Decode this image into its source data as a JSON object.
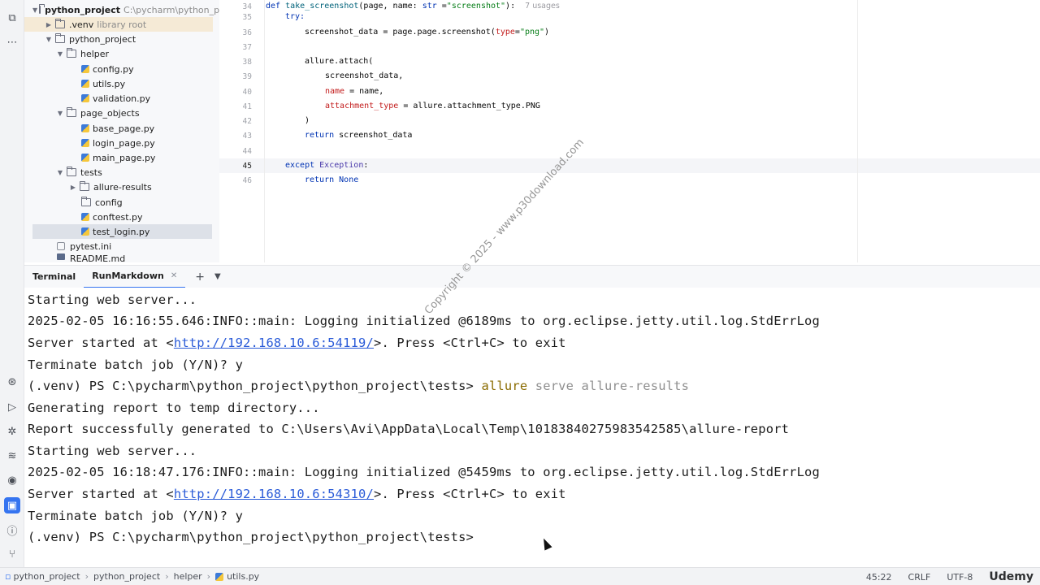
{
  "project_tree": {
    "root": {
      "name": "python_project",
      "path": "C:\\pycharm\\python_project"
    },
    "venv": {
      "name": ".venv",
      "note": "library root"
    },
    "inner_project": "python_project",
    "helper": {
      "name": "helper",
      "files": [
        "config.py",
        "utils.py",
        "validation.py"
      ]
    },
    "page_objects": {
      "name": "page_objects",
      "files": [
        "base_page.py",
        "login_page.py",
        "main_page.py"
      ]
    },
    "tests": {
      "name": "tests",
      "allure_results": "allure-results",
      "config": "config",
      "files": [
        "conftest.py",
        "test_login.py"
      ]
    },
    "pytest_ini": "pytest.ini",
    "readme": "README.md"
  },
  "editor": {
    "line_numbers": [
      "34",
      "35",
      "36",
      "37",
      "38",
      "39",
      "40",
      "41",
      "42",
      "43",
      "44",
      "45",
      "46"
    ],
    "def_kw": "def",
    "func_name": "take_screenshot",
    "def_args_a": "(page, name: ",
    "def_type": "str",
    "def_args_b": " =",
    "def_default": "\"screenshot\"",
    "def_end": "):",
    "usages": "7 usages",
    "try_kw": "try:",
    "l36_a": "screenshot_data = page.page.screenshot(",
    "l36_param": "type",
    "l36_eq": "=",
    "l36_str": "\"png\"",
    "l36_end": ")",
    "l38": "allure.attach(",
    "l39": "screenshot_data,",
    "l40_param": "name",
    "l40_rest": " = name,",
    "l41_param": "attachment_type",
    "l41_rest": " = allure.attachment_type.PNG",
    "l42": ")",
    "l43_kw": "return",
    "l43_rest": " screenshot_data",
    "l45_kw": "except",
    "l45_cls": "Exception",
    "l45_end": ":",
    "l46_kw": "return",
    "l46_none": "None"
  },
  "terminal": {
    "tabs": [
      "Terminal",
      "RunMarkdown"
    ],
    "lines": [
      {
        "text": "Starting web server..."
      },
      {
        "text": "2025-02-05 16:16:55.646:INFO::main: Logging initialized @6189ms to org.eclipse.jetty.util.log.StdErrLog"
      },
      {
        "pre": "Server started at <",
        "link": "http://192.168.10.6:54119/",
        "post": ">. Press <Ctrl+C> to exit"
      },
      {
        "text": "Terminate batch job (Y/N)? y"
      },
      {
        "prompt": "(.venv) PS C:\\pycharm\\python_project\\python_project\\tests> ",
        "cmd": "allure",
        "args": " serve allure-results"
      },
      {
        "text": "Generating report to temp directory..."
      },
      {
        "text": "Report successfully generated to C:\\Users\\Avi\\AppData\\Local\\Temp\\10183840275983542585\\allure-report"
      },
      {
        "text": "Starting web server..."
      },
      {
        "text": "2025-02-05 16:18:47.176:INFO::main: Logging initialized @5459ms to org.eclipse.jetty.util.log.StdErrLog"
      },
      {
        "pre": "Server started at <",
        "link": "http://192.168.10.6:54310/",
        "post": ">. Press <Ctrl+C> to exit"
      },
      {
        "text": "Terminate batch job (Y/N)? y"
      },
      {
        "text": "(.venv) PS C:\\pycharm\\python_project\\python_project\\tests>"
      }
    ]
  },
  "status_bar": {
    "breadcrumbs": [
      "python_project",
      "python_project",
      "helper",
      "utils.py"
    ],
    "position": "45:22",
    "line_sep": "CRLF",
    "encoding": "UTF-8",
    "brand": "Udemy"
  },
  "watermark": "Copyright © 2025 - www.p30download.com",
  "colors": {
    "accent": "#3574f0",
    "link": "#2a5bd8",
    "keyword": "#0033b3",
    "string": "#067d17"
  }
}
